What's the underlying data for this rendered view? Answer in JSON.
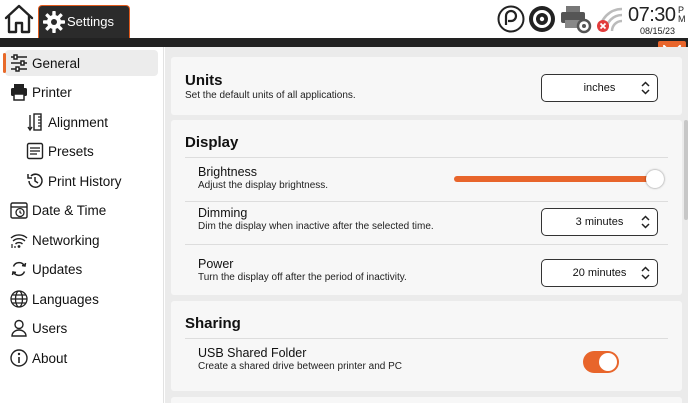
{
  "app": {
    "tab_label": "Settings"
  },
  "status": {
    "time": "07:30",
    "ampm_top": "P",
    "ampm_bottom": "M",
    "date": "08/15/23"
  },
  "icons": {
    "home": "home-icon",
    "settings": "gear-icon",
    "phone": "phone-status-icon",
    "disc": "disc-status-icon",
    "printer": "printer-settings-icon",
    "wifi": "wifi-disconnected-icon",
    "close": "close-icon"
  },
  "colors": {
    "accent": "#e8652b",
    "dark": "#222222"
  },
  "sidebar": {
    "items": [
      {
        "label": "General",
        "icon": "sliders-icon"
      },
      {
        "label": "Printer",
        "icon": "printer-icon"
      },
      {
        "label": "Alignment",
        "icon": "alignment-icon"
      },
      {
        "label": "Presets",
        "icon": "presets-icon"
      },
      {
        "label": "Print History",
        "icon": "history-icon"
      },
      {
        "label": "Date & Time",
        "icon": "calendar-clock-icon"
      },
      {
        "label": "Networking",
        "icon": "network-icon"
      },
      {
        "label": "Updates",
        "icon": "updates-icon"
      },
      {
        "label": "Languages",
        "icon": "globe-icon"
      },
      {
        "label": "Users",
        "icon": "user-icon"
      },
      {
        "label": "About",
        "icon": "info-icon"
      }
    ]
  },
  "units": {
    "title": "Units",
    "desc": "Set the default units of all applications.",
    "value": "inches"
  },
  "display": {
    "title": "Display",
    "brightness": {
      "title": "Brightness",
      "desc": "Adjust the display brightness.",
      "level": 1.0
    },
    "dimming": {
      "title": "Dimming",
      "desc": "Dim the display when inactive after the selected time.",
      "value": "3 minutes"
    },
    "power": {
      "title": "Power",
      "desc": "Turn the display off after the period of inactivity.",
      "value": "20 minutes"
    }
  },
  "sharing": {
    "title": "Sharing",
    "usb": {
      "title": "USB Shared Folder",
      "desc": "Create a shared drive between printer and PC",
      "enabled": true
    }
  }
}
